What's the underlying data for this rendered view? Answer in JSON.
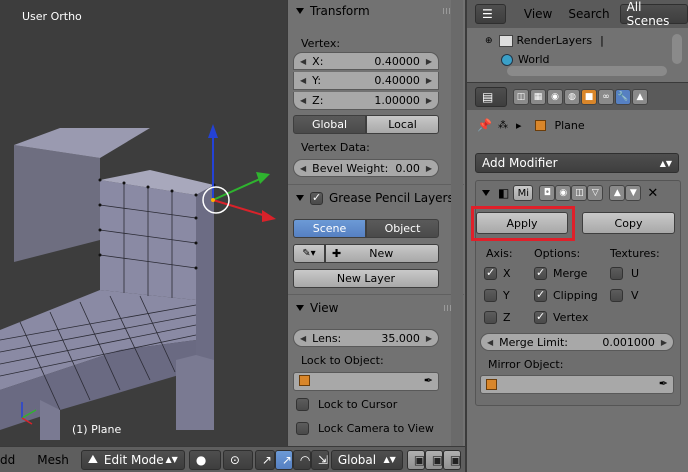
{
  "viewport": {
    "view_label": "User Ortho",
    "object_label": "(1) Plane"
  },
  "transform_panel": {
    "title": "Transform",
    "vertex_label": "Vertex:",
    "x": {
      "name": "X:",
      "value": "0.40000"
    },
    "y": {
      "name": "Y:",
      "value": "0.40000"
    },
    "z": {
      "name": "Z:",
      "value": "1.00000"
    },
    "global_label": "Global",
    "local_label": "Local",
    "vertex_data_label": "Vertex Data:",
    "bevel_weight": {
      "name": "Bevel Weight:",
      "value": "0.00"
    }
  },
  "grease_panel": {
    "title": "Grease Pencil Layers",
    "scene_label": "Scene",
    "object_label": "Object",
    "new_label": "New",
    "new_layer_label": "New Layer"
  },
  "view_panel": {
    "title": "View",
    "lens": {
      "name": "Lens:",
      "value": "35.000"
    },
    "lock_to_object_label": "Lock to Object:",
    "lock_to_cursor_label": "Lock to Cursor",
    "lock_camera_label": "Lock Camera to View"
  },
  "outliner": {
    "view_menu": "View",
    "search_menu": "Search",
    "scene_filter": "All Scenes",
    "items": [
      "RenderLayers",
      "World"
    ]
  },
  "properties": {
    "object_name": "Plane",
    "add_modifier_label": "Add Modifier",
    "modifier_short": "Mi",
    "apply_label": "Apply",
    "copy_label": "Copy",
    "axis_header": "Axis:",
    "options_header": "Options:",
    "textures_header": "Textures:",
    "axis_x": "X",
    "axis_y": "Y",
    "axis_z": "Z",
    "opt_merge": "Merge",
    "opt_clipping": "Clipping",
    "opt_vertex": "Vertex",
    "tex_u": "U",
    "tex_v": "V",
    "merge_limit": {
      "name": "Merge Limit:",
      "value": "0.001000"
    },
    "mirror_object_label": "Mirror Object:"
  },
  "bottombar": {
    "add_menu": "dd",
    "mesh_menu": "Mesh",
    "mode": "Edit Mode",
    "orientation": "Global"
  },
  "colors": {
    "highlight_red": "#e0202a",
    "selected_blue": "#5680c2",
    "axis_x": "#d9222a",
    "axis_y": "#2fb32f",
    "axis_z": "#2442d6"
  }
}
